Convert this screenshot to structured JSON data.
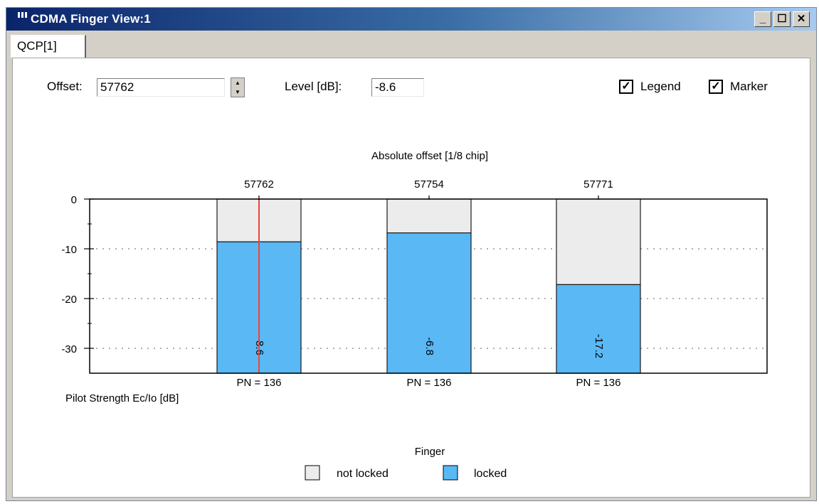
{
  "window": {
    "title": "CDMA Finger View:1",
    "minimize_label": "_",
    "maximize_label": "☐",
    "close_label": "✕"
  },
  "tabs": [
    {
      "label": "QCP[1]"
    }
  ],
  "controls": {
    "offset_label": "Offset:",
    "offset_value": "57762",
    "level_label": "Level [dB]:",
    "level_value": "-8.6",
    "legend_label": "Legend",
    "legend_checked": true,
    "marker_label": "Marker",
    "marker_checked": true
  },
  "chart_data": {
    "type": "bar",
    "title": "Absolute offset [1/8 chip]",
    "ylabel": "Pilot Strength Ec/Io [dB]",
    "ylim": [
      -35,
      0
    ],
    "yticks": [
      0,
      -10,
      -20,
      -30
    ],
    "grid": true,
    "categories": [
      "57762",
      "57754",
      "57771"
    ],
    "series": [
      {
        "name": "locked",
        "values": [
          -8.6,
          -6.8,
          -17.2
        ]
      }
    ],
    "data_labels": [
      "-8.6",
      "-6.8",
      "-17.2"
    ],
    "bar_bottom_labels": [
      "PN = 136",
      "PN = 136",
      "PN = 136"
    ],
    "marker_category": "57762",
    "legend": {
      "title": "Finger",
      "placement": "bottom",
      "entries": [
        {
          "label": "not locked",
          "color": "#ececec"
        },
        {
          "label": "locked",
          "color": "#5ab8f5"
        }
      ]
    },
    "colors": {
      "locked": "#5ab8f5",
      "not_locked": "#ececec",
      "marker": "#e8463a"
    }
  }
}
